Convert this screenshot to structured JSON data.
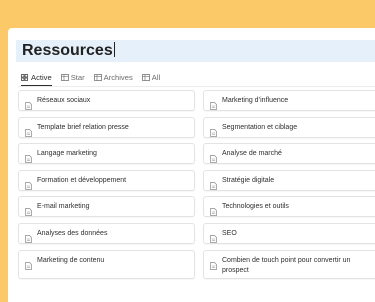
{
  "page": {
    "title": "Ressources"
  },
  "tabs": [
    {
      "label": "Active",
      "icon": "grid-icon",
      "active": true
    },
    {
      "label": "Star",
      "icon": "table-icon",
      "active": false
    },
    {
      "label": "Archives",
      "icon": "table-icon",
      "active": false
    },
    {
      "label": "All",
      "icon": "table-icon",
      "active": false
    }
  ],
  "cards": [
    {
      "label": "Réseaux sociaux",
      "icon": "page-icon"
    },
    {
      "label": "Marketing d’influence",
      "icon": "page-icon"
    },
    {
      "label": "Template brief relation presse",
      "icon": "page-icon"
    },
    {
      "label": "Segmentation et ciblage",
      "icon": "page-icon"
    },
    {
      "label": "Langage marketing",
      "icon": "page-icon"
    },
    {
      "label": "Analyse de marché",
      "icon": "page-icon"
    },
    {
      "label": "Formation et développement",
      "icon": "page-icon"
    },
    {
      "label": "Stratégie digitale",
      "icon": "page-icon"
    },
    {
      "label": "E-mail marketing",
      "icon": "page-icon"
    },
    {
      "label": "Technologies et outils",
      "icon": "page-icon"
    },
    {
      "label": "Analyses des données",
      "icon": "page-icon"
    },
    {
      "label": "SEO",
      "icon": "page-icon"
    },
    {
      "label": "Marketing de contenu",
      "icon": "page-icon"
    },
    {
      "label": "Combien de touch point pour convertir un prospect",
      "icon": "page-icon"
    }
  ],
  "colors": {
    "background": "#fcc969",
    "title_highlight": "#e6f0fa"
  }
}
